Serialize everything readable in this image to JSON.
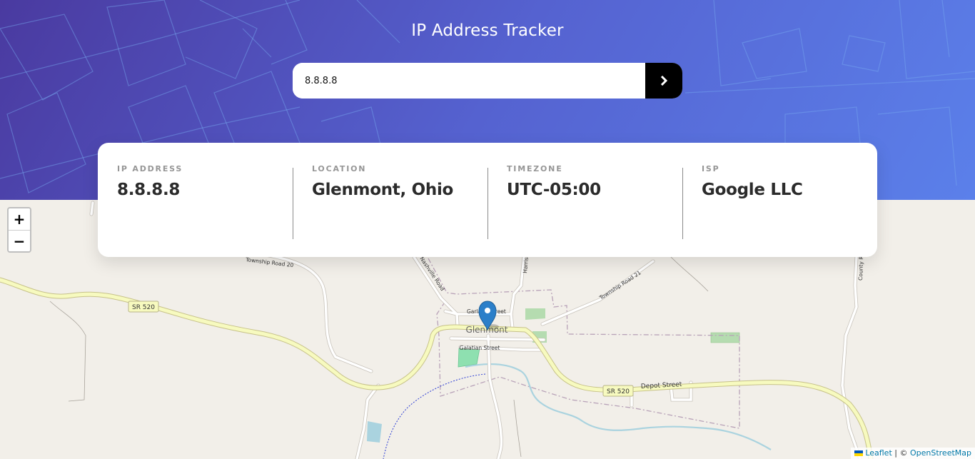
{
  "header": {
    "title": "IP Address Tracker",
    "gradient_colors": [
      "#4a3aa0",
      "#5562d0",
      "#5b80ea"
    ]
  },
  "search": {
    "value": "8.8.8.8",
    "button_icon": "chevron-right-icon"
  },
  "info": [
    {
      "label": "IP ADDRESS",
      "value": "8.8.8.8"
    },
    {
      "label": "LOCATION",
      "value": "Glenmont, Ohio"
    },
    {
      "label": "TIMEZONE",
      "value": "UTC-05:00"
    },
    {
      "label": "ISP",
      "value": "Google LLC"
    }
  ],
  "map": {
    "zoom_in": "+",
    "zoom_out": "−",
    "place_name": "Glenmont",
    "streets": {
      "garland": "Garland Street",
      "galatian": "Galatian Street",
      "depot": "Depot Street",
      "township21": "Township Road 21",
      "township20": "Township Road 20",
      "nashville": "Nashville Road",
      "harrison": "Harrison",
      "county": "County R"
    },
    "shields": {
      "sr520_left": "SR 520",
      "sr520_right": "SR 520"
    },
    "marker_color": "#2b7fc9",
    "attribution": {
      "leaflet": "Leaflet",
      "separator": " | © ",
      "osm": "OpenStreetMap"
    }
  }
}
